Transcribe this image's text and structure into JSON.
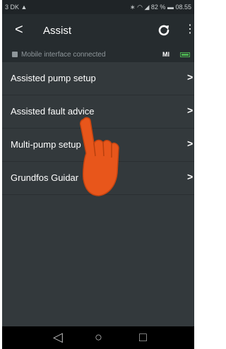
{
  "status_bar": {
    "carrier": "3 DK",
    "battery_percent": "82 %",
    "time": "08.55"
  },
  "app_bar": {
    "title": "Assist",
    "back_icon": "back-arrow-icon",
    "refresh_icon": "refresh-icon",
    "more_icon": "more-vert-icon"
  },
  "connection": {
    "text": "Mobile interface connected",
    "device_label": "MI"
  },
  "menu": {
    "items": [
      {
        "label": "Assisted pump setup"
      },
      {
        "label": "Assisted fault advice"
      },
      {
        "label": "Multi-pump setup"
      },
      {
        "label": "Grundfos Guidar"
      }
    ]
  },
  "colors": {
    "background": "#33393c",
    "app_bar": "#262c2f",
    "hand_overlay": "#e8561b",
    "battery": "#4caf50"
  }
}
